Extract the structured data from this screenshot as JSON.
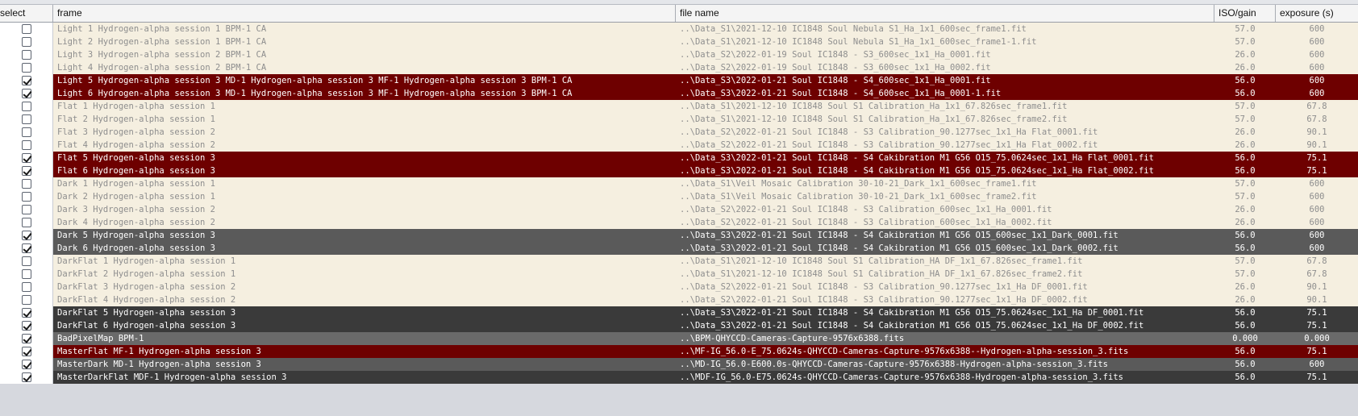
{
  "columns": {
    "select": "select",
    "frame": "frame",
    "file_name": "file name",
    "iso_gain": "ISO/gain",
    "exposure": "exposure (s)"
  },
  "row_colors": {
    "unselected_bg": "#f5efe0",
    "red": "#6e0000",
    "gray": "#5a5a5a",
    "dark": "#3a3a3a"
  },
  "rows": [
    {
      "checked": false,
      "style": "unsel",
      "frame": "Light 1 Hydrogen-alpha session 1   BPM-1  CA",
      "file": "..\\Data_S1\\2021-12-10 IC1848 Soul Nebula S1_Ha_1x1_600sec_frame1.fit",
      "iso": "57.0",
      "exposure": "600"
    },
    {
      "checked": false,
      "style": "unsel",
      "frame": "Light 2 Hydrogen-alpha session 1   BPM-1  CA",
      "file": "..\\Data_S1\\2021-12-10 IC1848 Soul Nebula S1_Ha_1x1_600sec_frame1-1.fit",
      "iso": "57.0",
      "exposure": "600"
    },
    {
      "checked": false,
      "style": "unsel",
      "frame": "Light 3 Hydrogen-alpha session 2   BPM-1  CA",
      "file": "..\\Data_S2\\2022-01-19 Soul IC1848 - S3_600sec_1x1_Ha_0001.fit",
      "iso": "26.0",
      "exposure": "600"
    },
    {
      "checked": false,
      "style": "unsel",
      "frame": "Light 4 Hydrogen-alpha session 2   BPM-1  CA",
      "file": "..\\Data_S2\\2022-01-19 Soul IC1848 - S3_600sec_1x1_Ha_0002.fit",
      "iso": "26.0",
      "exposure": "600"
    },
    {
      "checked": true,
      "style": "red",
      "frame": "Light 5 Hydrogen-alpha session 3   MD-1 Hydrogen-alpha session 3   MF-1 Hydrogen-alpha session 3   BPM-1  CA",
      "file": "..\\Data_S3\\2022-01-21 Soul IC1848 - S4_600sec_1x1_Ha_0001.fit",
      "iso": "56.0",
      "exposure": "600"
    },
    {
      "checked": true,
      "style": "red",
      "frame": "Light 6 Hydrogen-alpha session 3   MD-1 Hydrogen-alpha session 3   MF-1 Hydrogen-alpha session 3   BPM-1  CA",
      "file": "..\\Data_S3\\2022-01-21 Soul IC1848 - S4_600sec_1x1_Ha_0001-1.fit",
      "iso": "56.0",
      "exposure": "600"
    },
    {
      "checked": false,
      "style": "unsel",
      "frame": "Flat 1 Hydrogen-alpha session 1",
      "file": "..\\Data_S1\\2021-12-10 IC1848 Soul S1 Calibration_Ha_1x1_67.826sec_frame1.fit",
      "iso": "57.0",
      "exposure": "67.8"
    },
    {
      "checked": false,
      "style": "unsel",
      "frame": "Flat 2 Hydrogen-alpha session 1",
      "file": "..\\Data_S1\\2021-12-10 IC1848 Soul S1 Calibration_Ha_1x1_67.826sec_frame2.fit",
      "iso": "57.0",
      "exposure": "67.8"
    },
    {
      "checked": false,
      "style": "unsel",
      "frame": "Flat 3 Hydrogen-alpha session 2",
      "file": "..\\Data_S2\\2022-01-21 Soul IC1848 - S3 Calibration_90.1277sec_1x1_Ha Flat_0001.fit",
      "iso": "26.0",
      "exposure": "90.1"
    },
    {
      "checked": false,
      "style": "unsel",
      "frame": "Flat 4 Hydrogen-alpha session 2",
      "file": "..\\Data_S2\\2022-01-21 Soul IC1848 - S3 Calibration_90.1277sec_1x1_Ha Flat_0002.fit",
      "iso": "26.0",
      "exposure": "90.1"
    },
    {
      "checked": true,
      "style": "red",
      "frame": "Flat 5 Hydrogen-alpha session 3",
      "file": "..\\Data_S3\\2022-01-21 Soul IC1848 - S4 Cakibration M1 G56 O15_75.0624sec_1x1_Ha Flat_0001.fit",
      "iso": "56.0",
      "exposure": "75.1"
    },
    {
      "checked": true,
      "style": "red",
      "frame": "Flat 6 Hydrogen-alpha session 3",
      "file": "..\\Data_S3\\2022-01-21 Soul IC1848 - S4 Cakibration M1 G56 O15_75.0624sec_1x1_Ha Flat_0002.fit",
      "iso": "56.0",
      "exposure": "75.1"
    },
    {
      "checked": false,
      "style": "unsel",
      "frame": "Dark 1 Hydrogen-alpha session 1",
      "file": "..\\Data_S1\\Veil Mosaic Calibration 30-10-21_Dark_1x1_600sec_frame1.fit",
      "iso": "57.0",
      "exposure": "600"
    },
    {
      "checked": false,
      "style": "unsel",
      "frame": "Dark 2 Hydrogen-alpha session 1",
      "file": "..\\Data_S1\\Veil Mosaic Calibration 30-10-21_Dark_1x1_600sec_frame2.fit",
      "iso": "57.0",
      "exposure": "600"
    },
    {
      "checked": false,
      "style": "unsel",
      "frame": "Dark 3 Hydrogen-alpha session 2",
      "file": "..\\Data_S2\\2022-01-21 Soul IC1848 - S3 Calibration_600sec_1x1_Ha_0001.fit",
      "iso": "26.0",
      "exposure": "600"
    },
    {
      "checked": false,
      "style": "unsel",
      "frame": "Dark 4 Hydrogen-alpha session 2",
      "file": "..\\Data_S2\\2022-01-21 Soul IC1848 - S3 Calibration_600sec_1x1_Ha_0002.fit",
      "iso": "26.0",
      "exposure": "600"
    },
    {
      "checked": true,
      "style": "gray",
      "frame": "Dark 5 Hydrogen-alpha session 3",
      "file": "..\\Data_S3\\2022-01-21 Soul IC1848 - S4 Cakibration M1 G56 O15_600sec_1x1_Dark_0001.fit",
      "iso": "56.0",
      "exposure": "600"
    },
    {
      "checked": true,
      "style": "gray",
      "frame": "Dark 6 Hydrogen-alpha session 3",
      "file": "..\\Data_S3\\2022-01-21 Soul IC1848 - S4 Cakibration M1 G56 O15_600sec_1x1_Dark_0002.fit",
      "iso": "56.0",
      "exposure": "600"
    },
    {
      "checked": false,
      "style": "unsel",
      "frame": "DarkFlat 1 Hydrogen-alpha session 1",
      "file": "..\\Data_S1\\2021-12-10 IC1848 Soul S1 Calibration_HA DF_1x1_67.826sec_frame1.fit",
      "iso": "57.0",
      "exposure": "67.8"
    },
    {
      "checked": false,
      "style": "unsel",
      "frame": "DarkFlat 2 Hydrogen-alpha session 1",
      "file": "..\\Data_S1\\2021-12-10 IC1848 Soul S1 Calibration_HA DF_1x1_67.826sec_frame2.fit",
      "iso": "57.0",
      "exposure": "67.8"
    },
    {
      "checked": false,
      "style": "unsel",
      "frame": "DarkFlat 3 Hydrogen-alpha session 2",
      "file": "..\\Data_S2\\2022-01-21 Soul IC1848 - S3 Calibration_90.1277sec_1x1_Ha DF_0001.fit",
      "iso": "26.0",
      "exposure": "90.1"
    },
    {
      "checked": false,
      "style": "unsel",
      "frame": "DarkFlat 4 Hydrogen-alpha session 2",
      "file": "..\\Data_S2\\2022-01-21 Soul IC1848 - S3 Calibration_90.1277sec_1x1_Ha DF_0002.fit",
      "iso": "26.0",
      "exposure": "90.1"
    },
    {
      "checked": true,
      "style": "dark",
      "frame": "DarkFlat 5 Hydrogen-alpha session 3",
      "file": "..\\Data_S3\\2022-01-21 Soul IC1848 - S4 Cakibration M1 G56 O15_75.0624sec_1x1_Ha DF_0001.fit",
      "iso": "56.0",
      "exposure": "75.1"
    },
    {
      "checked": true,
      "style": "dark",
      "frame": "DarkFlat 6 Hydrogen-alpha session 3",
      "file": "..\\Data_S3\\2022-01-21 Soul IC1848 - S4 Cakibration M1 G56 O15_75.0624sec_1x1_Ha DF_0002.fit",
      "iso": "56.0",
      "exposure": "75.1"
    },
    {
      "checked": true,
      "style": "mid",
      "frame": "BadPixelMap  BPM-1",
      "file": "..\\BPM-QHYCCD-Cameras-Capture-9576x6388.fits",
      "iso": "0.000",
      "exposure": "0.000"
    },
    {
      "checked": true,
      "style": "red",
      "frame": "MasterFlat  MF-1 Hydrogen-alpha session 3",
      "file": "..\\MF-IG_56.0-E_75.0624s-QHYCCD-Cameras-Capture-9576x6388--Hydrogen-alpha-session_3.fits",
      "iso": "56.0",
      "exposure": "75.1"
    },
    {
      "checked": true,
      "style": "gray",
      "frame": "MasterDark  MD-1 Hydrogen-alpha session 3",
      "file": "..\\MD-IG_56.0-E600.0s-QHYCCD-Cameras-Capture-9576x6388-Hydrogen-alpha-session_3.fits",
      "iso": "56.0",
      "exposure": "600"
    },
    {
      "checked": true,
      "style": "dark",
      "frame": "MasterDarkFlat  MDF-1 Hydrogen-alpha session 3",
      "file": "..\\MDF-IG_56.0-E75.0624s-QHYCCD-Cameras-Capture-9576x6388-Hydrogen-alpha-session_3.fits",
      "iso": "56.0",
      "exposure": "75.1"
    }
  ]
}
